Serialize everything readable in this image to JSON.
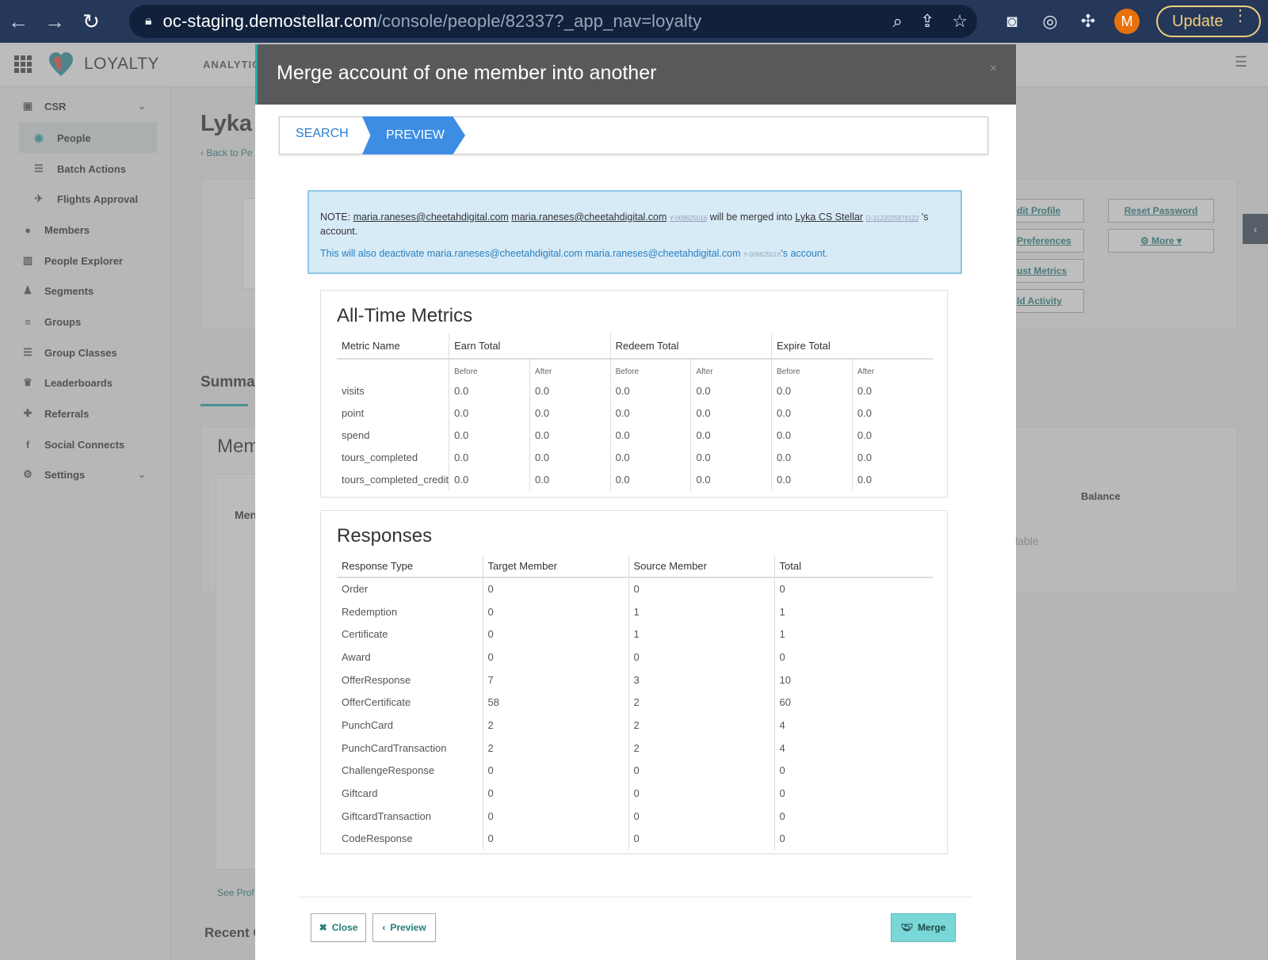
{
  "browser": {
    "url_host": "oc-staging.demostellar.com",
    "url_path": "/console/people/82337?_app_nav=loyalty",
    "update_label": "Update",
    "avatar_letter": "M"
  },
  "app": {
    "brand": "LOYALTY",
    "topnav_item": "ANALYTICS",
    "sidebar": [
      {
        "label": "CSR",
        "icon": "lock-icon",
        "glyph": "🔒",
        "top": 0
      },
      {
        "label": "People",
        "icon": "person-circle-icon",
        "glyph": "◉"
      },
      {
        "label": "Batch Actions",
        "icon": "list-icon",
        "glyph": "☰"
      },
      {
        "label": "Flights Approval",
        "icon": "plane-icon",
        "glyph": "✈"
      },
      {
        "label": "Members",
        "icon": "user-icon",
        "glyph": "●"
      },
      {
        "label": "People Explorer",
        "icon": "bar-chart-icon",
        "glyph": "▥"
      },
      {
        "label": "Segments",
        "icon": "users-icon",
        "glyph": "♟"
      },
      {
        "label": "Groups",
        "icon": "list-ul-icon",
        "glyph": "≡"
      },
      {
        "label": "Group Classes",
        "icon": "bars-icon",
        "glyph": "☰"
      },
      {
        "label": "Leaderboards",
        "icon": "trophy-icon",
        "glyph": "♛"
      },
      {
        "label": "Referrals",
        "icon": "user-plus-icon",
        "glyph": "✚"
      },
      {
        "label": "Social Connects",
        "icon": "facebook-icon",
        "glyph": "f"
      },
      {
        "label": "Settings",
        "icon": "cogs-icon",
        "glyph": "⚙"
      }
    ],
    "bg": {
      "title_fragment": "Lyka C",
      "back_link": "Back to Pe",
      "summary": "Summar",
      "mem": "Mem",
      "men": "Men",
      "see_profile": "See Prof",
      "recent": "Recent O",
      "edit_profile": "dit Profile",
      "reset_password": "Reset Password",
      "preferences": "Preferences",
      "more": "More",
      "adjust_metrics": "ust Metrics",
      "add_activity": "ld Activity",
      "balance": "Balance",
      "available": "lable"
    }
  },
  "modal": {
    "title": "Merge account of one member into another",
    "steps": {
      "search": "SEARCH",
      "preview": "PREVIEW"
    },
    "note": {
      "prefix": "NOTE:",
      "source_email_1": "maria.raneses@cheetahdigital.com",
      "source_email_2": "maria.raneses@cheetahdigital.com",
      "source_id": "Y-009625016",
      "middle": "will be merged into",
      "target_name": "Lyka CS Stellar",
      "target_id": "O-3122025979122",
      "suffix": "'s",
      "account": "account.",
      "deactivate_prefix": "This will also deactivate",
      "deactivate_suffix": "'s account."
    },
    "metrics": {
      "title": "All-Time Metrics",
      "headers": [
        "Metric Name",
        "Earn Total",
        "Redeem Total",
        "Expire Total"
      ],
      "before": "Before",
      "after": "After",
      "rows": [
        {
          "name": "visits",
          "values": [
            "0.0",
            "0.0",
            "0.0",
            "0.0",
            "0.0",
            "0.0"
          ]
        },
        {
          "name": "point",
          "values": [
            "0.0",
            "0.0",
            "0.0",
            "0.0",
            "0.0",
            "0.0"
          ]
        },
        {
          "name": "spend",
          "values": [
            "0.0",
            "0.0",
            "0.0",
            "0.0",
            "0.0",
            "0.0"
          ]
        },
        {
          "name": "tours_completed",
          "values": [
            "0.0",
            "0.0",
            "0.0",
            "0.0",
            "0.0",
            "0.0"
          ]
        },
        {
          "name": "tours_completed_credit",
          "values": [
            "0.0",
            "0.0",
            "0.0",
            "0.0",
            "0.0",
            "0.0"
          ]
        }
      ]
    },
    "responses": {
      "title": "Responses",
      "headers": [
        "Response Type",
        "Target Member",
        "Source Member",
        "Total"
      ],
      "rows": [
        [
          "Order",
          "0",
          "0",
          "0"
        ],
        [
          "Redemption",
          "0",
          "1",
          "1"
        ],
        [
          "Certificate",
          "0",
          "1",
          "1"
        ],
        [
          "Award",
          "0",
          "0",
          "0"
        ],
        [
          "OfferResponse",
          "7",
          "3",
          "10"
        ],
        [
          "OfferCertificate",
          "58",
          "2",
          "60"
        ],
        [
          "PunchCard",
          "2",
          "2",
          "4"
        ],
        [
          "PunchCardTransaction",
          "2",
          "2",
          "4"
        ],
        [
          "ChallengeResponse",
          "0",
          "0",
          "0"
        ],
        [
          "Giftcard",
          "0",
          "0",
          "0"
        ],
        [
          "GiftcardTransaction",
          "0",
          "0",
          "0"
        ],
        [
          "CodeResponse",
          "0",
          "0",
          "0"
        ]
      ]
    },
    "buttons": {
      "close": "Close",
      "preview": "Preview",
      "merge": "Merge"
    }
  }
}
